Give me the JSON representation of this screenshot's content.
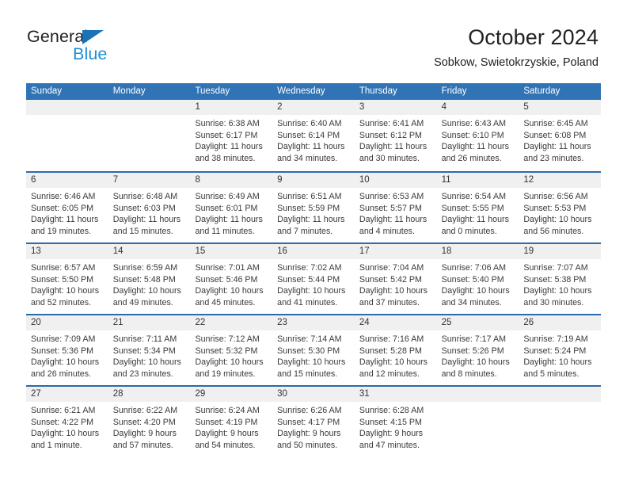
{
  "brand": {
    "name_dark": "General",
    "name_blue": "Blue",
    "accent_blue": "#1a8fd6",
    "triangle_blue": "#1a72b8"
  },
  "header": {
    "title": "October 2024",
    "subtitle": "Sobkow, Swietokrzyskie, Poland"
  },
  "calendar": {
    "header_bg": "#3174b5",
    "row_divider": "#2a6ba9",
    "daynum_bg": "#f0f0f0",
    "weekday_names": [
      "Sunday",
      "Monday",
      "Tuesday",
      "Wednesday",
      "Thursday",
      "Friday",
      "Saturday"
    ],
    "weeks": [
      [
        {
          "day": "",
          "lines": []
        },
        {
          "day": "",
          "lines": []
        },
        {
          "day": "1",
          "lines": [
            "Sunrise: 6:38 AM",
            "Sunset: 6:17 PM",
            "Daylight: 11 hours",
            "and 38 minutes."
          ]
        },
        {
          "day": "2",
          "lines": [
            "Sunrise: 6:40 AM",
            "Sunset: 6:14 PM",
            "Daylight: 11 hours",
            "and 34 minutes."
          ]
        },
        {
          "day": "3",
          "lines": [
            "Sunrise: 6:41 AM",
            "Sunset: 6:12 PM",
            "Daylight: 11 hours",
            "and 30 minutes."
          ]
        },
        {
          "day": "4",
          "lines": [
            "Sunrise: 6:43 AM",
            "Sunset: 6:10 PM",
            "Daylight: 11 hours",
            "and 26 minutes."
          ]
        },
        {
          "day": "5",
          "lines": [
            "Sunrise: 6:45 AM",
            "Sunset: 6:08 PM",
            "Daylight: 11 hours",
            "and 23 minutes."
          ]
        }
      ],
      [
        {
          "day": "6",
          "lines": [
            "Sunrise: 6:46 AM",
            "Sunset: 6:05 PM",
            "Daylight: 11 hours",
            "and 19 minutes."
          ]
        },
        {
          "day": "7",
          "lines": [
            "Sunrise: 6:48 AM",
            "Sunset: 6:03 PM",
            "Daylight: 11 hours",
            "and 15 minutes."
          ]
        },
        {
          "day": "8",
          "lines": [
            "Sunrise: 6:49 AM",
            "Sunset: 6:01 PM",
            "Daylight: 11 hours",
            "and 11 minutes."
          ]
        },
        {
          "day": "9",
          "lines": [
            "Sunrise: 6:51 AM",
            "Sunset: 5:59 PM",
            "Daylight: 11 hours",
            "and 7 minutes."
          ]
        },
        {
          "day": "10",
          "lines": [
            "Sunrise: 6:53 AM",
            "Sunset: 5:57 PM",
            "Daylight: 11 hours",
            "and 4 minutes."
          ]
        },
        {
          "day": "11",
          "lines": [
            "Sunrise: 6:54 AM",
            "Sunset: 5:55 PM",
            "Daylight: 11 hours",
            "and 0 minutes."
          ]
        },
        {
          "day": "12",
          "lines": [
            "Sunrise: 6:56 AM",
            "Sunset: 5:53 PM",
            "Daylight: 10 hours",
            "and 56 minutes."
          ]
        }
      ],
      [
        {
          "day": "13",
          "lines": [
            "Sunrise: 6:57 AM",
            "Sunset: 5:50 PM",
            "Daylight: 10 hours",
            "and 52 minutes."
          ]
        },
        {
          "day": "14",
          "lines": [
            "Sunrise: 6:59 AM",
            "Sunset: 5:48 PM",
            "Daylight: 10 hours",
            "and 49 minutes."
          ]
        },
        {
          "day": "15",
          "lines": [
            "Sunrise: 7:01 AM",
            "Sunset: 5:46 PM",
            "Daylight: 10 hours",
            "and 45 minutes."
          ]
        },
        {
          "day": "16",
          "lines": [
            "Sunrise: 7:02 AM",
            "Sunset: 5:44 PM",
            "Daylight: 10 hours",
            "and 41 minutes."
          ]
        },
        {
          "day": "17",
          "lines": [
            "Sunrise: 7:04 AM",
            "Sunset: 5:42 PM",
            "Daylight: 10 hours",
            "and 37 minutes."
          ]
        },
        {
          "day": "18",
          "lines": [
            "Sunrise: 7:06 AM",
            "Sunset: 5:40 PM",
            "Daylight: 10 hours",
            "and 34 minutes."
          ]
        },
        {
          "day": "19",
          "lines": [
            "Sunrise: 7:07 AM",
            "Sunset: 5:38 PM",
            "Daylight: 10 hours",
            "and 30 minutes."
          ]
        }
      ],
      [
        {
          "day": "20",
          "lines": [
            "Sunrise: 7:09 AM",
            "Sunset: 5:36 PM",
            "Daylight: 10 hours",
            "and 26 minutes."
          ]
        },
        {
          "day": "21",
          "lines": [
            "Sunrise: 7:11 AM",
            "Sunset: 5:34 PM",
            "Daylight: 10 hours",
            "and 23 minutes."
          ]
        },
        {
          "day": "22",
          "lines": [
            "Sunrise: 7:12 AM",
            "Sunset: 5:32 PM",
            "Daylight: 10 hours",
            "and 19 minutes."
          ]
        },
        {
          "day": "23",
          "lines": [
            "Sunrise: 7:14 AM",
            "Sunset: 5:30 PM",
            "Daylight: 10 hours",
            "and 15 minutes."
          ]
        },
        {
          "day": "24",
          "lines": [
            "Sunrise: 7:16 AM",
            "Sunset: 5:28 PM",
            "Daylight: 10 hours",
            "and 12 minutes."
          ]
        },
        {
          "day": "25",
          "lines": [
            "Sunrise: 7:17 AM",
            "Sunset: 5:26 PM",
            "Daylight: 10 hours",
            "and 8 minutes."
          ]
        },
        {
          "day": "26",
          "lines": [
            "Sunrise: 7:19 AM",
            "Sunset: 5:24 PM",
            "Daylight: 10 hours",
            "and 5 minutes."
          ]
        }
      ],
      [
        {
          "day": "27",
          "lines": [
            "Sunrise: 6:21 AM",
            "Sunset: 4:22 PM",
            "Daylight: 10 hours",
            "and 1 minute."
          ]
        },
        {
          "day": "28",
          "lines": [
            "Sunrise: 6:22 AM",
            "Sunset: 4:20 PM",
            "Daylight: 9 hours",
            "and 57 minutes."
          ]
        },
        {
          "day": "29",
          "lines": [
            "Sunrise: 6:24 AM",
            "Sunset: 4:19 PM",
            "Daylight: 9 hours",
            "and 54 minutes."
          ]
        },
        {
          "day": "30",
          "lines": [
            "Sunrise: 6:26 AM",
            "Sunset: 4:17 PM",
            "Daylight: 9 hours",
            "and 50 minutes."
          ]
        },
        {
          "day": "31",
          "lines": [
            "Sunrise: 6:28 AM",
            "Sunset: 4:15 PM",
            "Daylight: 9 hours",
            "and 47 minutes."
          ]
        },
        {
          "day": "",
          "lines": []
        },
        {
          "day": "",
          "lines": []
        }
      ]
    ]
  }
}
